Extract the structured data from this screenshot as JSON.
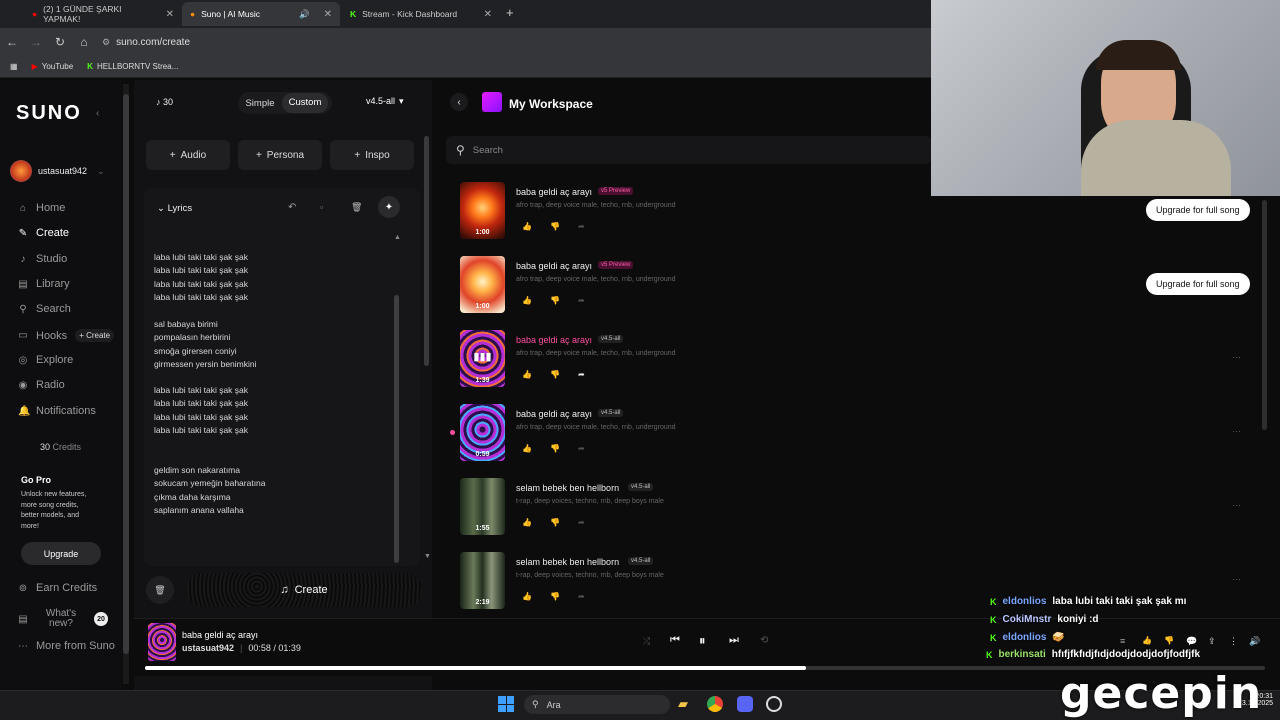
{
  "browser": {
    "tabs": [
      {
        "label": "(2) 1 GÜNDE ŞARKI YAPMAK!"
      },
      {
        "label": "Suno | AI Music"
      },
      {
        "label": "Stream - Kick Dashboard"
      }
    ],
    "url": "suno.com/create",
    "bookmarks": [
      "YouTube",
      "HELLBORNTV Strea..."
    ]
  },
  "sidebar": {
    "logo": "SUNO",
    "username": "ustasuat942",
    "items": [
      {
        "label": "Home"
      },
      {
        "label": "Create"
      },
      {
        "label": "Studio"
      },
      {
        "label": "Library"
      },
      {
        "label": "Search"
      },
      {
        "label": "Hooks"
      },
      {
        "label": "Explore"
      },
      {
        "label": "Radio"
      },
      {
        "label": "Notifications"
      }
    ],
    "hooks_create": "+ Create",
    "credits_num": "30",
    "credits_label": "Credits",
    "gopro_title": "Go Pro",
    "gopro_text": "Unlock new features, more song credits, better models, and more!",
    "upgrade": "Upgrade",
    "earn": "Earn Credits",
    "whats_new": "What's new?",
    "whats_new_count": "20",
    "more": "More from Suno"
  },
  "create": {
    "credits": "30",
    "mode_simple": "Simple",
    "mode_custom": "Custom",
    "model": "v4.5-all",
    "audio": "Audio",
    "persona": "Persona",
    "inspo": "Inspo",
    "lyrics_label": "Lyrics",
    "lyrics": [
      "laba lubi taki taki şak şak\nlaba lubi taki taki şak şak\nlaba lubi taki taki şak şak\nlaba lubi taki taki şak şak",
      "sal babaya birimi\npompalasın herbirini\nsmoğa girersen coniyi\ngirmessen yersin benimkini",
      "laba lubi taki taki şak şak\nlaba lubi taki taki şak şak\nlaba lubi taki taki şak şak\nlaba lubi taki taki şak şak",
      "geldim son nakaratıma\nsokucam yemeğin baharatına\nçıkma daha karşıma\nsaplanım anana vallaha"
    ],
    "create_btn": "Create"
  },
  "workspace": {
    "title": "My Workspace",
    "search_placeholder": "Search",
    "upgrade_label": "Upgrade for full song",
    "songs": [
      {
        "title": "baba geldi aç arayı",
        "version": "v5 Preview",
        "tags": "afro trap, deep voice male, techo, rnb, underground",
        "duration": "1:00"
      },
      {
        "title": "baba geldi aç arayı",
        "version": "v5 Preview",
        "tags": "afro trap, deep voice male, techo, rnb, underground",
        "duration": "1:00"
      },
      {
        "title": "baba geldi aç arayı",
        "version": "v4.5-all",
        "tags": "afro trap, deep voice male, techo, rnb, underground",
        "duration": "1:39"
      },
      {
        "title": "baba geldi aç arayı",
        "version": "v4.5-all",
        "tags": "afro trap, deep voice male, techo, rnb, underground",
        "duration": "0:59"
      },
      {
        "title": "selam bebek ben hellborn",
        "version": "v4.5-all",
        "tags": "t-rap, deep voices, techno, rnb, deep boys male",
        "duration": "1:55"
      },
      {
        "title": "selam bebek ben hellborn",
        "version": "v4.5-all",
        "tags": "t-rap, deep voices, techno, rnb, deep boys male",
        "duration": "2:19"
      }
    ]
  },
  "player": {
    "title": "baba geldi aç arayı",
    "artist": "ustasuat942",
    "time": "00:58 / 01:39",
    "progress": 0.59
  },
  "chat": [
    {
      "user": "eldonlios",
      "msg": "laba lubi taki taki şak şak mı",
      "color": "#7aa7ff"
    },
    {
      "user": "CokiMnstr",
      "msg": "koniyi :d",
      "color": "#b9c6ff"
    },
    {
      "user": "eldonlios",
      "msg": "🥪",
      "color": "#7aa7ff"
    },
    {
      "user": "berkinsati",
      "msg": "hfıfjfkfıdjfıdjdodjdodjdofjfodfjfk",
      "color": "#9be36b"
    }
  ],
  "taskbar": {
    "search": "Ara",
    "time": "20:31",
    "date": "23.10.2025"
  },
  "watermark": "gecepin"
}
